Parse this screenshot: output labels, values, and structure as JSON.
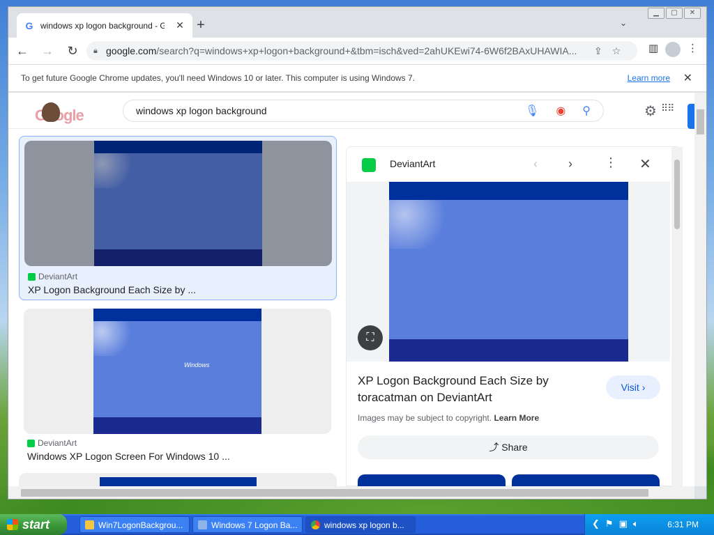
{
  "browser": {
    "tab_title": "windows xp logon background - Goo",
    "tab_favicon": "G",
    "new_tab": "+",
    "url_host": "google.com",
    "url_path": "/search?q=windows+xp+logon+background+&tbm=isch&ved=2ahUKEwi74-6W6f2BAxUHAWIA...",
    "infobar_text": "To get future Google Chrome updates, you'll need Windows 10 or later. This computer is using Windows 7.",
    "infobar_link": "Learn more"
  },
  "search": {
    "query": "windows xp logon background",
    "doodle_letters": "Google"
  },
  "results": [
    {
      "source": "DeviantArt",
      "title": "XP Logon Background Each Size by ..."
    },
    {
      "source": "DeviantArt",
      "title": "Windows XP Logon Screen For Windows 10 ...",
      "logo_text": "Windows"
    }
  ],
  "preview": {
    "source": "DeviantArt",
    "title": "XP Logon Background Each Size by toracatman on DeviantArt",
    "visit_label": "Visit",
    "copyright_text": "Images may be subject to copyright.",
    "copyright_link": "Learn More",
    "share_label": "Share"
  },
  "taskbar": {
    "start_label": "start",
    "tasks": [
      {
        "label": "Win7LogonBackgrou..."
      },
      {
        "label": "Windows 7 Logon Ba..."
      },
      {
        "label": "windows xp logon b..."
      }
    ],
    "clock": "6:31 PM"
  },
  "colors": {
    "accent": "#1a73e8",
    "deviantart": "#05cc47",
    "xp_blue": "#5a7edc"
  }
}
